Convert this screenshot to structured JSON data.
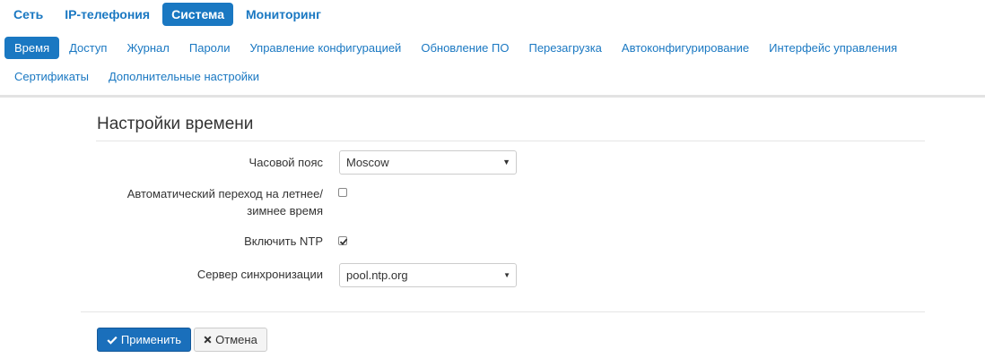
{
  "top_nav": {
    "items": [
      {
        "label": "Сеть"
      },
      {
        "label": "IP-телефония"
      },
      {
        "label": "Система"
      },
      {
        "label": "Мониторинг"
      }
    ],
    "active_index": 2
  },
  "sub_nav": {
    "items": [
      {
        "label": "Время"
      },
      {
        "label": "Доступ"
      },
      {
        "label": "Журнал"
      },
      {
        "label": "Пароли"
      },
      {
        "label": "Управление конфигурацией"
      },
      {
        "label": "Обновление ПО"
      },
      {
        "label": "Перезагрузка"
      },
      {
        "label": "Автоконфигурирование"
      },
      {
        "label": "Интерфейс управления"
      },
      {
        "label": "Сертификаты"
      },
      {
        "label": "Дополнительные настройки"
      }
    ],
    "active_index": 0
  },
  "section": {
    "title": "Настройки времени"
  },
  "form": {
    "timezone": {
      "label": "Часовой пояс",
      "value": "Moscow"
    },
    "dst": {
      "label_line1": "Автоматический переход на летнее/",
      "label_line2": "зимнее время",
      "checked": false
    },
    "ntp": {
      "label": "Включить NTP",
      "checked": true
    },
    "sync_server": {
      "label": "Сервер синхронизации",
      "value": "pool.ntp.org"
    }
  },
  "buttons": {
    "apply": {
      "label": "Применить",
      "icon": "check-icon"
    },
    "cancel": {
      "label": "Отмена",
      "icon": "close-icon"
    }
  },
  "colors": {
    "accent": "#1a78c2",
    "apply_button": "#1a6fbb"
  }
}
